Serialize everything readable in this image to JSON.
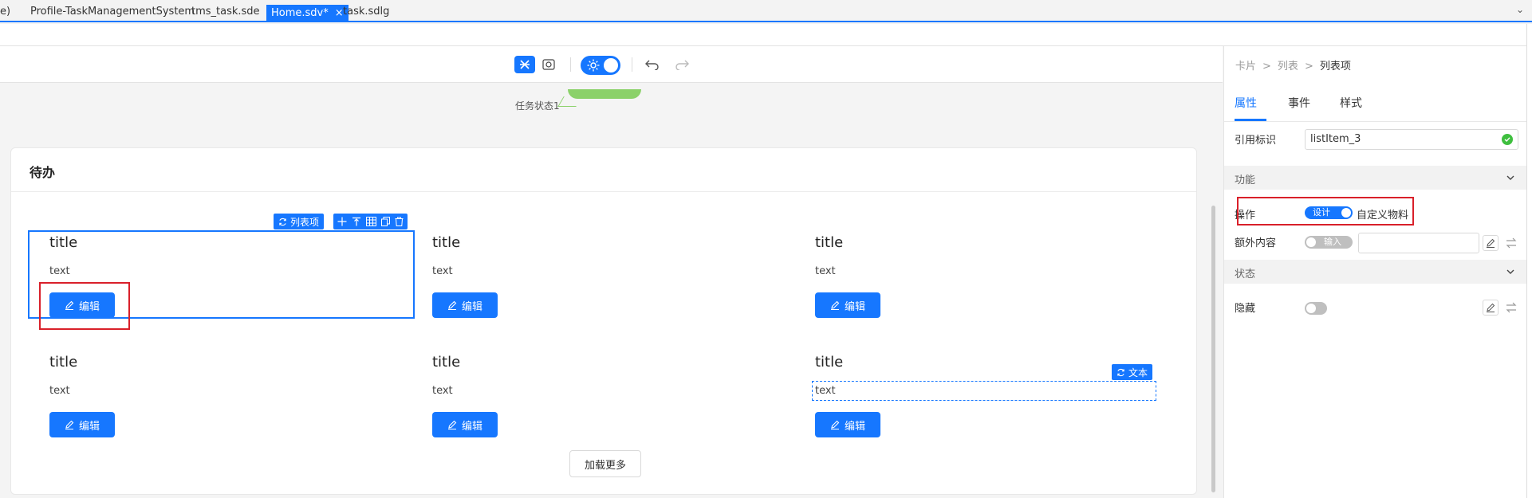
{
  "tabs": [
    {
      "label": "e)"
    },
    {
      "label": "Profile-TaskManagementSystem"
    },
    {
      "label": "tms_task.sde"
    },
    {
      "label": "Home.sdv*",
      "active": true
    },
    {
      "label": "task.sdlg"
    }
  ],
  "tab_close": "×",
  "tab_overflow": "⌄",
  "toolbar": {
    "icons": [
      "design-mode-icon",
      "preview-icon",
      "theme-toggle",
      "undo-icon",
      "redo-icon"
    ],
    "accent": "#1677ff"
  },
  "chart_fragment": {
    "label": "任务状态1",
    "color": "#8bd16a"
  },
  "card": {
    "title": "待办",
    "items": [
      {
        "title": "title",
        "text": "text",
        "button": "编辑"
      },
      {
        "title": "title",
        "text": "text",
        "button": "编辑"
      },
      {
        "title": "title",
        "text": "text",
        "button": "编辑"
      },
      {
        "title": "title",
        "text": "text",
        "button": "编辑"
      },
      {
        "title": "title",
        "text": "text",
        "button": "编辑"
      },
      {
        "title": "title",
        "text": "text",
        "button": "编辑"
      }
    ],
    "load_more": "加载更多",
    "selection_tag": "列表项",
    "text_tag": "文本"
  },
  "panel": {
    "breadcrumb": [
      "卡片",
      "列表",
      "列表项"
    ],
    "tabs": [
      "属性",
      "事件",
      "样式"
    ],
    "active_tab": "属性",
    "ref_label": "引用标识",
    "ref_value": "listItem_3",
    "section_function": "功能",
    "operate_label": "操作",
    "operate_switch_text": "设计",
    "operate_value": "自定义物料",
    "extra_label": "额外内容",
    "extra_switch_text": "输入",
    "section_state": "状态",
    "hidden_label": "隐藏"
  },
  "colors": {
    "primary": "#1677ff",
    "highlight": "#d9202a",
    "success": "#3fbf3f"
  }
}
